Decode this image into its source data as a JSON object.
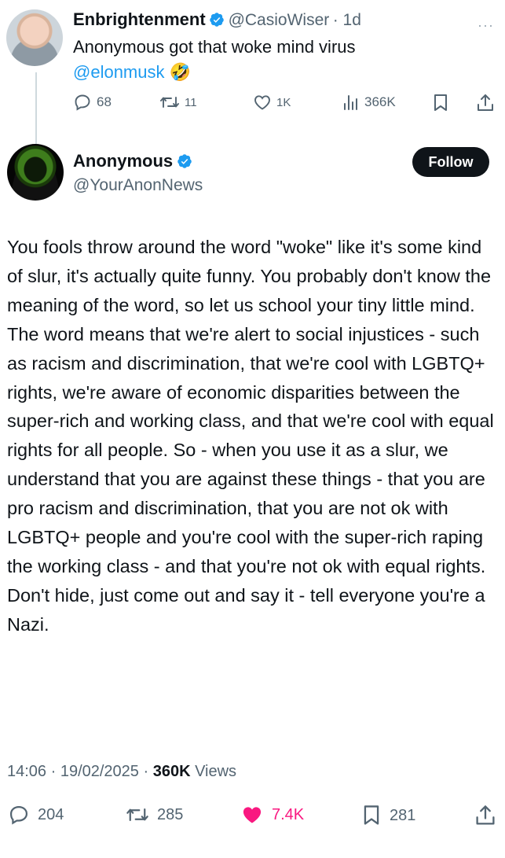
{
  "reply_tweet": {
    "name": "Enbrightenment",
    "handle": "@CasioWiser",
    "time": "· 1d",
    "text": "Anonymous got that woke mind virus",
    "mention": "@elonmusk",
    "emoji": "🤣",
    "more": "···",
    "actions": {
      "replies": "68",
      "reposts": "11",
      "likes": "1K",
      "views": "366K"
    }
  },
  "main_tweet": {
    "name": "Anonymous",
    "handle": "@YourAnonNews",
    "follow_label": "Follow",
    "paragraphs": [
      "You fools throw around the word \"woke\" like it's some kind of slur, it's actually quite funny.  You probably don't know the meaning of the word, so let us school your tiny little mind.",
      "The word means that we're alert to social injustices - such as racism and discrimination, that we're cool with LGBTQ+ rights, we're aware of economic disparities between the super-rich and working class, and that we're cool with equal rights for all people.  So - when you use it as a slur, we understand that you are against these things - that you are pro racism and discrimination, that you are not ok with LGBTQ+ people and you're cool with the super-rich raping the working class - and that you're not ok with equal rights.  Don't hide, just come out and say it - tell everyone you're a Nazi."
    ],
    "timestamp": "14:06 · 19/02/2025 · ",
    "views_count": "360K",
    "views_label": " Views",
    "actions": {
      "replies": "204",
      "reposts": "285",
      "likes": "7.4K",
      "bookmarks": "281"
    }
  },
  "colors": {
    "accent": "#1d9bf0",
    "like_active": "#f91880",
    "muted": "#536471"
  }
}
